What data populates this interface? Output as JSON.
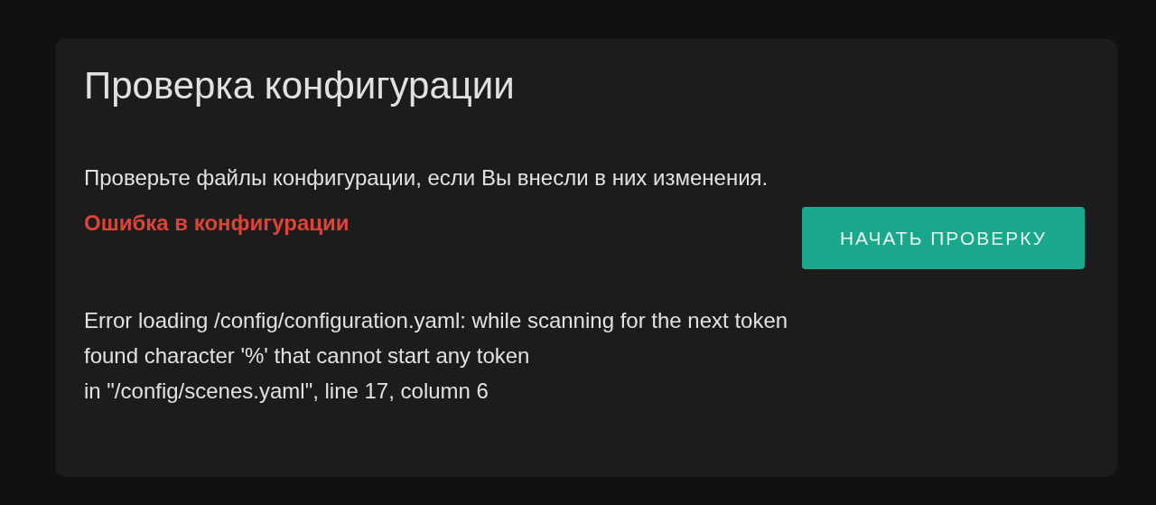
{
  "card": {
    "title": "Проверка конфигурации",
    "description": "Проверьте файлы конфигурации, если Вы внесли в них изменения.",
    "result": {
      "kind": "error",
      "text": "Ошибка в конфигурации"
    },
    "button": "НАЧАТЬ ПРОВЕРКУ",
    "error_lines": [
      "Error loading /config/configuration.yaml: while scanning for the next token",
      "found character '%' that cannot start any token",
      "in \"/config/scenes.yaml\", line 17, column 6"
    ]
  }
}
